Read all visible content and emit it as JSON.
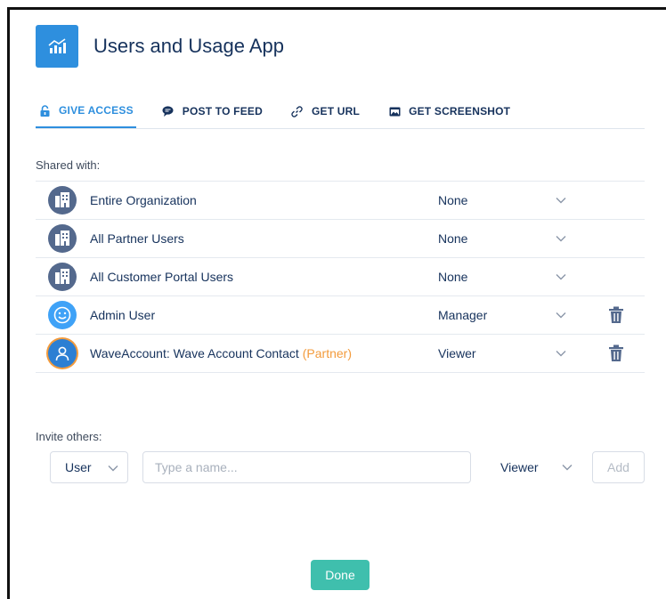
{
  "app": {
    "title": "Users and Usage App",
    "icon": "analytics-chart-icon",
    "accent_color": "#2e8fde"
  },
  "tabs": [
    {
      "label": "GIVE ACCESS",
      "icon": "lock-icon",
      "active": true
    },
    {
      "label": "POST TO FEED",
      "icon": "chat-bubble-icon",
      "active": false
    },
    {
      "label": "GET URL",
      "icon": "link-icon",
      "active": false
    },
    {
      "label": "GET SCREENSHOT",
      "icon": "image-icon",
      "active": false
    }
  ],
  "shared_with": {
    "label": "Shared with:",
    "rows": [
      {
        "name": "Entire Organization",
        "tag": "",
        "access": "None",
        "avatar": "building-icon",
        "deletable": false
      },
      {
        "name": "All Partner Users",
        "tag": "",
        "access": "None",
        "avatar": "building-icon",
        "deletable": false
      },
      {
        "name": "All Customer Portal Users",
        "tag": "",
        "access": "None",
        "avatar": "building-icon",
        "deletable": false
      },
      {
        "name": "Admin User",
        "tag": "",
        "access": "Manager",
        "avatar": "smiley-avatar-icon",
        "deletable": true
      },
      {
        "name": "WaveAccount: Wave Account Contact",
        "tag": "(Partner)",
        "access": "Viewer",
        "avatar": "person-icon",
        "deletable": true
      }
    ]
  },
  "invite": {
    "label": "Invite others:",
    "type_value": "User",
    "name_placeholder": "Type a name...",
    "name_value": "",
    "role_value": "Viewer",
    "add_label": "Add"
  },
  "done_label": "Done",
  "colors": {
    "partner_tag": "#f39b3c",
    "done_button": "#3fbfad"
  }
}
